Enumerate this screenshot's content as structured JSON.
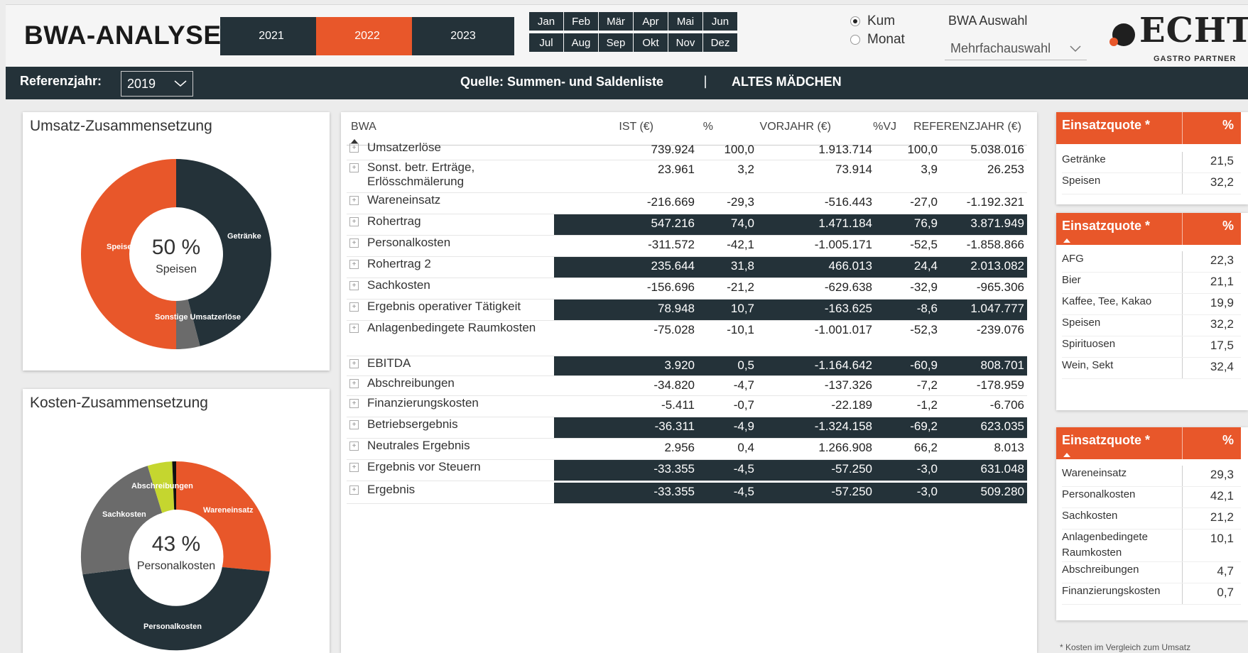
{
  "header": {
    "title": "BWA-ANALYSE",
    "years": [
      "2021",
      "2022",
      "2023"
    ],
    "active_year": "2022",
    "months_row1": [
      "Jan",
      "Feb",
      "Mär",
      "Apr",
      "Mai",
      "Jun"
    ],
    "months_row2": [
      "Jul",
      "Aug",
      "Sep",
      "Okt",
      "Nov",
      "Dez"
    ],
    "mode_options": [
      "Kum",
      "Monat"
    ],
    "mode_selected": "Kum",
    "bwa_label": "BWA Auswahl",
    "bwa_value": "Mehrfachauswahl",
    "logo_text": "ECHT",
    "logo_sub": "GASTRO PARTNER",
    "colors": {
      "brand": "#e8572a",
      "dark": "#243239"
    }
  },
  "bar": {
    "ref_label": "Referenzjahr:",
    "ref_value": "2019",
    "source": "Quelle: Summen- und Saldenliste",
    "separator": "|",
    "venue": "ALTES MÄDCHEN"
  },
  "umsatz": {
    "title": "Umsatz-Zusammensetzung",
    "center_value": "50 %",
    "center_label": "Speisen",
    "labels": {
      "speisen": "Speisen",
      "getraenke": "Getränke",
      "sonstige": "Sonstige Umsatzerlöse"
    }
  },
  "kosten": {
    "title": "Kosten-Zusammensetzung",
    "center_value": "43 %",
    "center_label": "Personalkosten",
    "labels": {
      "abschreibungen": "Abschreibungen",
      "wareneinsatz": "Wareneinsatz",
      "sachkosten": "Sachkosten",
      "personalkosten": "Personalkosten"
    }
  },
  "table": {
    "headers": [
      "BWA",
      "IST (€)",
      "%",
      "VORJAHR (€)",
      "%VJ",
      "REFERENZJAHR (€)"
    ],
    "rows": [
      {
        "label": "Umsatzerlöse",
        "ist": "739.924",
        "pct": "100,0",
        "vj": "1.913.714",
        "pvj": "100,0",
        "ref": "5.038.016",
        "hl": false
      },
      {
        "label": "Sonst. betr. Erträge, Erlösschmälerung",
        "ist": "23.961",
        "pct": "3,2",
        "vj": "73.914",
        "pvj": "3,9",
        "ref": "26.253",
        "hl": false
      },
      {
        "label": "Wareneinsatz",
        "ist": "-216.669",
        "pct": "-29,3",
        "vj": "-516.443",
        "pvj": "-27,0",
        "ref": "-1.192.321",
        "hl": false
      },
      {
        "label": "Rohertrag",
        "ist": "547.216",
        "pct": "74,0",
        "vj": "1.471.184",
        "pvj": "76,9",
        "ref": "3.871.949",
        "hl": true
      },
      {
        "label": "Personalkosten",
        "ist": "-311.572",
        "pct": "-42,1",
        "vj": "-1.005.171",
        "pvj": "-52,5",
        "ref": "-1.858.866",
        "hl": false
      },
      {
        "label": "Rohertrag 2",
        "ist": "235.644",
        "pct": "31,8",
        "vj": "466.013",
        "pvj": "24,4",
        "ref": "2.013.082",
        "hl": true
      },
      {
        "label": "Sachkosten",
        "ist": "-156.696",
        "pct": "-21,2",
        "vj": "-629.638",
        "pvj": "-32,9",
        "ref": "-965.306",
        "hl": false
      },
      {
        "label": "Ergebnis operativer Tätigkeit",
        "ist": "78.948",
        "pct": "10,7",
        "vj": "-163.625",
        "pvj": "-8,6",
        "ref": "1.047.777",
        "hl": true
      },
      {
        "label": "Anlagenbedingete Raumkosten",
        "ist": "-75.028",
        "pct": "-10,1",
        "vj": "-1.001.017",
        "pvj": "-52,3",
        "ref": "-239.076",
        "hl": false
      },
      {
        "label": "EBITDA",
        "ist": "3.920",
        "pct": "0,5",
        "vj": "-1.164.642",
        "pvj": "-60,9",
        "ref": "808.701",
        "hl": true
      },
      {
        "label": "Abschreibungen",
        "ist": "-34.820",
        "pct": "-4,7",
        "vj": "-137.326",
        "pvj": "-7,2",
        "ref": "-178.959",
        "hl": false
      },
      {
        "label": "Finanzierungskosten",
        "ist": "-5.411",
        "pct": "-0,7",
        "vj": "-22.189",
        "pvj": "-1,2",
        "ref": "-6.706",
        "hl": false
      },
      {
        "label": "Betriebsergebnis",
        "ist": "-36.311",
        "pct": "-4,9",
        "vj": "-1.324.158",
        "pvj": "-69,2",
        "ref": "623.035",
        "hl": true
      },
      {
        "label": "Neutrales Ergebnis",
        "ist": "2.956",
        "pct": "0,4",
        "vj": "1.266.908",
        "pvj": "66,2",
        "ref": "8.013",
        "hl": false
      },
      {
        "label": "Ergebnis vor Steuern",
        "ist": "-33.355",
        "pct": "-4,5",
        "vj": "-57.250",
        "pvj": "-3,0",
        "ref": "631.048",
        "hl": true
      },
      {
        "label": "Ergebnis",
        "ist": "-33.355",
        "pct": "-4,5",
        "vj": "-57.250",
        "pvj": "-3,0",
        "ref": "509.280",
        "hl": true
      }
    ]
  },
  "panels": [
    {
      "title": "Einsatzquote *",
      "pct_header": "%",
      "rows": [
        {
          "name": "Getränke",
          "value": "21,5"
        },
        {
          "name": "Speisen",
          "value": "32,2"
        }
      ]
    },
    {
      "title": "Einsatzquote *",
      "pct_header": "%",
      "rows": [
        {
          "name": "AFG",
          "value": "22,3"
        },
        {
          "name": "Bier",
          "value": "21,1"
        },
        {
          "name": "Kaffee, Tee, Kakao",
          "value": "19,9"
        },
        {
          "name": "Speisen",
          "value": "32,2"
        },
        {
          "name": "Spirituosen",
          "value": "17,5"
        },
        {
          "name": "Wein, Sekt",
          "value": "32,4"
        }
      ]
    },
    {
      "title": "Einsatzquote *",
      "pct_header": "%",
      "rows": [
        {
          "name": "Wareneinsatz",
          "value": "29,3"
        },
        {
          "name": "Personalkosten",
          "value": "42,1"
        },
        {
          "name": "Sachkosten",
          "value": "21,2"
        },
        {
          "name": "Anlagenbedingete Raumkosten",
          "value": "10,1"
        },
        {
          "name": "Abschreibungen",
          "value": "4,7"
        },
        {
          "name": "Finanzierungskosten",
          "value": "0,7"
        }
      ]
    }
  ],
  "footnote": "* Kosten im Vergleich zum Umsatz"
}
